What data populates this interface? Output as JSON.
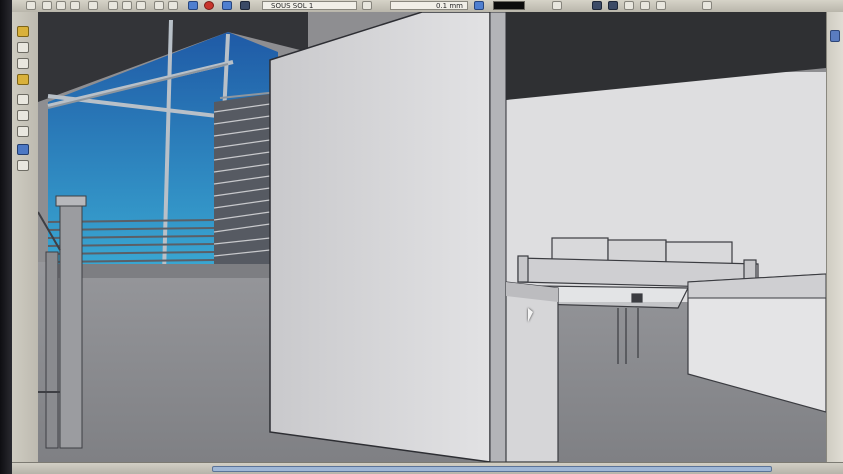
{
  "toolbar": {
    "layer_name": "SOUS SOL 1",
    "line_width": "0.1 mm"
  },
  "colors": {
    "sky_top": "#1f5aa6",
    "sky_bottom": "#37a6cf",
    "wall": "#dcdcde",
    "floor": "#8d8e92",
    "ceiling": "#2f3033"
  },
  "icons": {
    "stop": "stop-icon",
    "scroll_arrow": "scroll-up-arrow-icon"
  }
}
